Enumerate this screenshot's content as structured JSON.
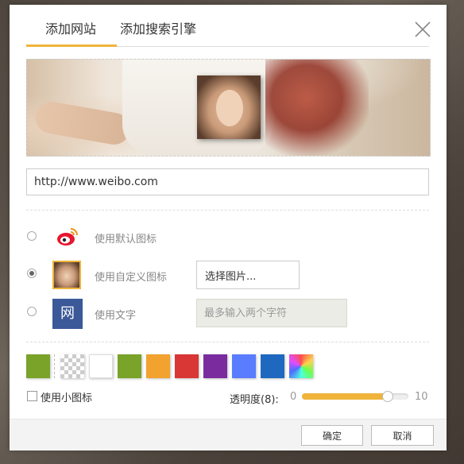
{
  "tabs": [
    {
      "label": "添加网站"
    },
    {
      "label": "添加搜索引擎"
    }
  ],
  "url_input": {
    "value": "http://www.weibo.com"
  },
  "icon_options": [
    {
      "label": "使用默认图标",
      "icon": "weibo-icon",
      "checked": false
    },
    {
      "label": "使用自定义图标",
      "icon": "custom-image-icon",
      "checked": true,
      "button_label": "选择图片..."
    },
    {
      "label": "使用文字",
      "icon_text": "网",
      "checked": false,
      "placeholder": "最多输入两个字符"
    }
  ],
  "swatches": [
    {
      "name": "green",
      "color": "#7aa329"
    },
    {
      "name": "transparent",
      "color": "transparent"
    },
    {
      "name": "white",
      "color": "#ffffff"
    },
    {
      "name": "green-2",
      "color": "#7aa329"
    },
    {
      "name": "orange",
      "color": "#f2a22e"
    },
    {
      "name": "red",
      "color": "#d93636"
    },
    {
      "name": "purple",
      "color": "#7a2c9e"
    },
    {
      "name": "blue",
      "color": "#5a7cff"
    },
    {
      "name": "dark-blue",
      "color": "#1f68c0"
    },
    {
      "name": "custom",
      "color": "rainbow"
    }
  ],
  "small_icon": {
    "label": "使用小图标",
    "checked": false
  },
  "opacity": {
    "label": "透明度(8):",
    "min_label": "0",
    "max_label": "10",
    "value": 8
  },
  "buttons": {
    "ok": "确定",
    "cancel": "取消"
  }
}
